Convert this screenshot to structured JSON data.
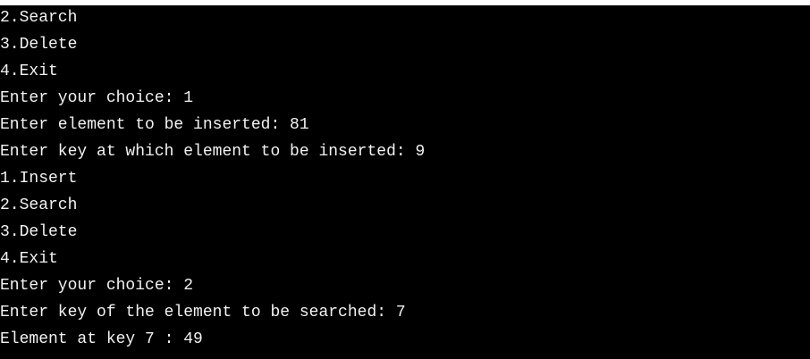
{
  "console": {
    "lines": [
      "2.Search",
      "3.Delete",
      "4.Exit",
      "Enter your choice: 1",
      "Enter element to be inserted: 81",
      "Enter key at which element to be inserted: 9",
      "1.Insert",
      "2.Search",
      "3.Delete",
      "4.Exit",
      "Enter your choice: 2",
      "Enter key of the element to be searched: 7",
      "Element at key 7 : 49"
    ]
  },
  "colors": {
    "background": "#000000",
    "text": "#f2f2f2"
  }
}
